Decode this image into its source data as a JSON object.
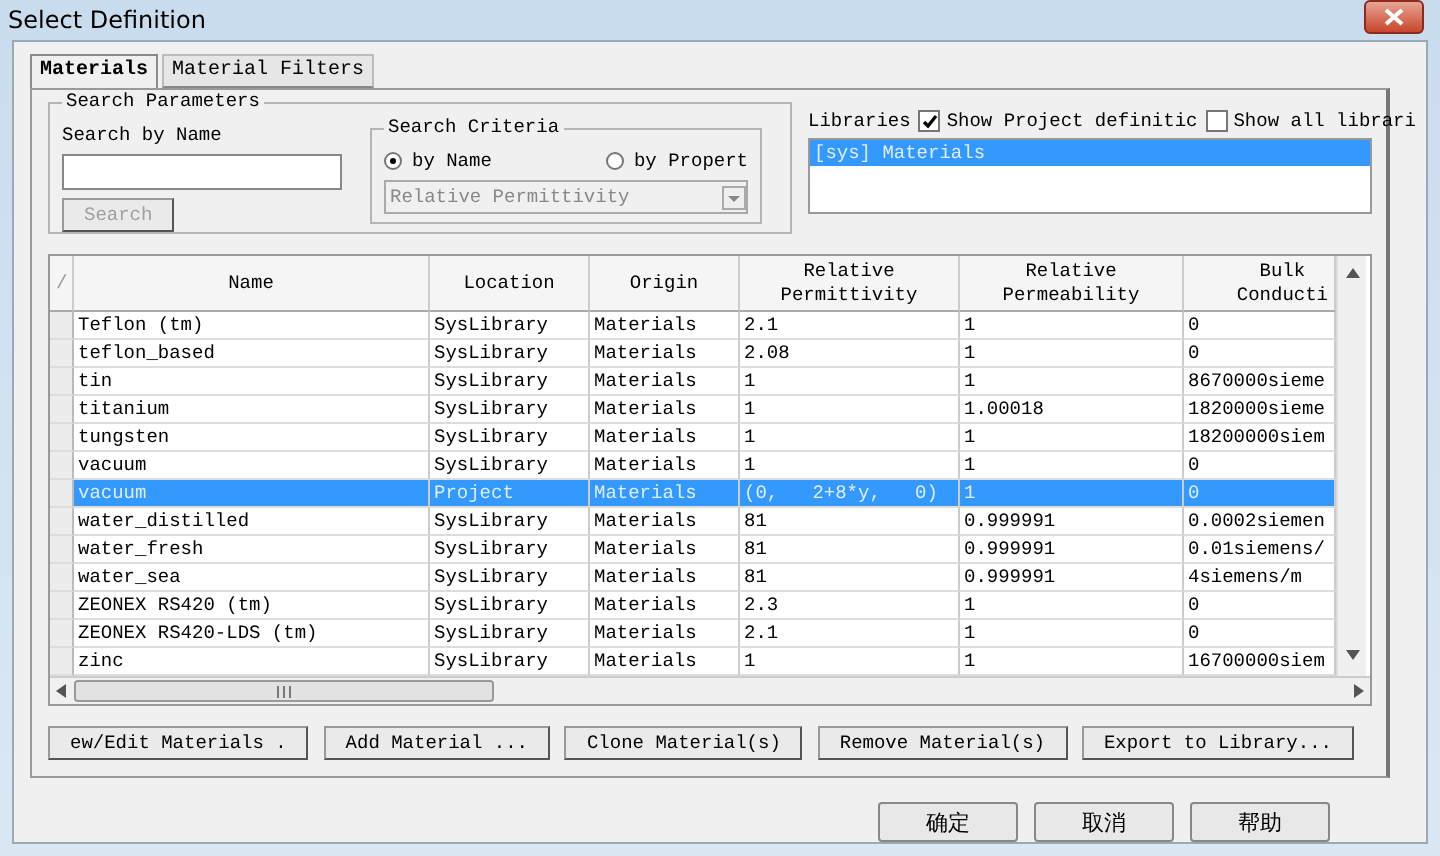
{
  "window": {
    "title": "Select Definition"
  },
  "tabs": [
    {
      "label": "Materials",
      "selected": true
    },
    {
      "label": "Material Filters",
      "selected": false
    }
  ],
  "search_parameters": {
    "title": "Search Parameters",
    "label": "Search by Name",
    "button": "Search",
    "button_disabled": true
  },
  "search_criteria": {
    "title": "Search Criteria",
    "options": [
      {
        "label": "by Name",
        "selected": true
      },
      {
        "label": "by Propert",
        "selected": false
      }
    ],
    "dropdown": "Relative Permittivity"
  },
  "libraries": {
    "label": "Libraries",
    "checkboxes": [
      {
        "label": "Show Project definitic",
        "checked": true
      },
      {
        "label": "Show all librari",
        "checked": false
      }
    ],
    "items": [
      {
        "label": "[sys] Materials",
        "selected": true
      }
    ]
  },
  "table": {
    "sort_mark": "/",
    "columns": [
      "Name",
      "Location",
      "Origin",
      "Relative Permittivity",
      "Relative Permeability",
      "Bulk Conducti"
    ],
    "rows": [
      {
        "cells": [
          "Teflon (tm)",
          "SysLibrary",
          "Materials",
          "2.1",
          "1",
          "0"
        ],
        "selected": false
      },
      {
        "cells": [
          "teflon_based",
          "SysLibrary",
          "Materials",
          "2.08",
          "1",
          "0"
        ],
        "selected": false
      },
      {
        "cells": [
          "tin",
          "SysLibrary",
          "Materials",
          "1",
          "1",
          "8670000sieme"
        ],
        "selected": false
      },
      {
        "cells": [
          "titanium",
          "SysLibrary",
          "Materials",
          "1",
          "1.00018",
          "1820000sieme"
        ],
        "selected": false
      },
      {
        "cells": [
          "tungsten",
          "SysLibrary",
          "Materials",
          "1",
          "1",
          "18200000siem"
        ],
        "selected": false
      },
      {
        "cells": [
          "vacuum",
          "SysLibrary",
          "Materials",
          "1",
          "1",
          "0"
        ],
        "selected": false
      },
      {
        "cells": [
          "vacuum",
          "Project",
          "Materials",
          "(0,   2+8*y,   0)",
          "1",
          "0"
        ],
        "selected": true
      },
      {
        "cells": [
          "water_distilled",
          "SysLibrary",
          "Materials",
          "81",
          "0.999991",
          "0.0002siemen"
        ],
        "selected": false
      },
      {
        "cells": [
          "water_fresh",
          "SysLibrary",
          "Materials",
          "81",
          "0.999991",
          "0.01siemens/"
        ],
        "selected": false
      },
      {
        "cells": [
          "water_sea",
          "SysLibrary",
          "Materials",
          "81",
          "0.999991",
          "4siemens/m"
        ],
        "selected": false
      },
      {
        "cells": [
          "ZEONEX RS420 (tm)",
          "SysLibrary",
          "Materials",
          "2.3",
          "1",
          "0"
        ],
        "selected": false
      },
      {
        "cells": [
          "ZEONEX RS420-LDS (tm)",
          "SysLibrary",
          "Materials",
          "2.1",
          "1",
          "0"
        ],
        "selected": false
      },
      {
        "cells": [
          "zinc",
          "SysLibrary",
          "Materials",
          "1",
          "1",
          "16700000siem"
        ],
        "selected": false
      }
    ]
  },
  "buttons": [
    "ew/Edit Materials .",
    "Add Material ...",
    "Clone Material(s)",
    "Remove Material(s)",
    "Export to Library..."
  ],
  "dialog_buttons": [
    "确定",
    "取消",
    "帮助"
  ]
}
